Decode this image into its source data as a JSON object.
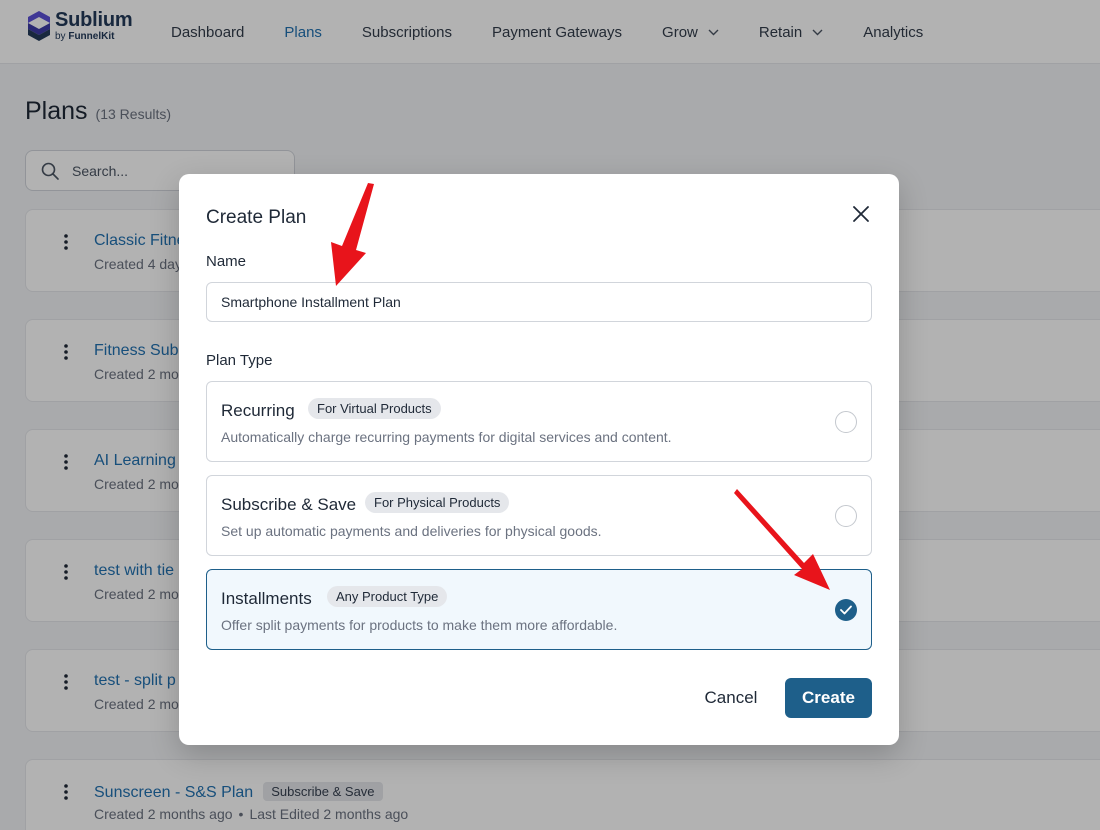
{
  "brand": {
    "name": "Sublium",
    "by_prefix": "by ",
    "by_name": "FunnelKit",
    "color": "#233a59"
  },
  "nav": {
    "items": [
      {
        "label": "Dashboard",
        "active": false
      },
      {
        "label": "Plans",
        "active": true
      },
      {
        "label": "Subscriptions",
        "active": false
      },
      {
        "label": "Payment Gateways",
        "active": false
      },
      {
        "label": "Grow",
        "active": false,
        "dropdown": true
      },
      {
        "label": "Retain",
        "active": false,
        "dropdown": true
      },
      {
        "label": "Analytics",
        "active": false
      }
    ],
    "active_color": "#2271b1"
  },
  "page": {
    "title": "Plans",
    "count": "(13 Results)",
    "search_placeholder": "Search..."
  },
  "plans": [
    {
      "name": "Classic Fitne",
      "meta": "Created 4 day"
    },
    {
      "name": "Fitness Sub",
      "meta": "Created 2 mo"
    },
    {
      "name": "AI Learning",
      "meta": "Created 2 mo"
    },
    {
      "name": "test with tie",
      "meta": "Created 2 mo"
    },
    {
      "name": "test - split p",
      "meta": "Created 2 mo"
    },
    {
      "name": "Sunscreen - S&S Plan",
      "badge": "Subscribe & Save",
      "meta_created": "Created 2 months ago",
      "meta_separator": "•",
      "meta_edited": "Last Edited 2 months ago"
    }
  ],
  "modal": {
    "title": "Create Plan",
    "name_label": "Name",
    "name_value": "Smartphone Installment Plan",
    "plan_type_label": "Plan Type",
    "plan_types": [
      {
        "title": "Recurring",
        "badge": "For Virtual Products",
        "description": "Automatically charge recurring payments for digital services and content.",
        "selected": false
      },
      {
        "title": "Subscribe & Save",
        "badge": "For Physical Products",
        "description": "Set up automatic payments and deliveries for physical goods.",
        "selected": false
      },
      {
        "title": "Installments",
        "badge": "Any Product Type",
        "description": "Offer split payments for products to make them more affordable.",
        "selected": true
      }
    ],
    "cancel_label": "Cancel",
    "create_label": "Create",
    "primary_color": "#1e5f8a"
  },
  "annotation_color": "#e8141b",
  "icons": {
    "logo": "sublium-logo-icon",
    "search": "search-icon",
    "menu": "kebab-menu-icon",
    "close": "close-icon",
    "dropdown": "chevron-down-icon",
    "check": "check-icon",
    "annotation": "red-arrow-icon"
  }
}
